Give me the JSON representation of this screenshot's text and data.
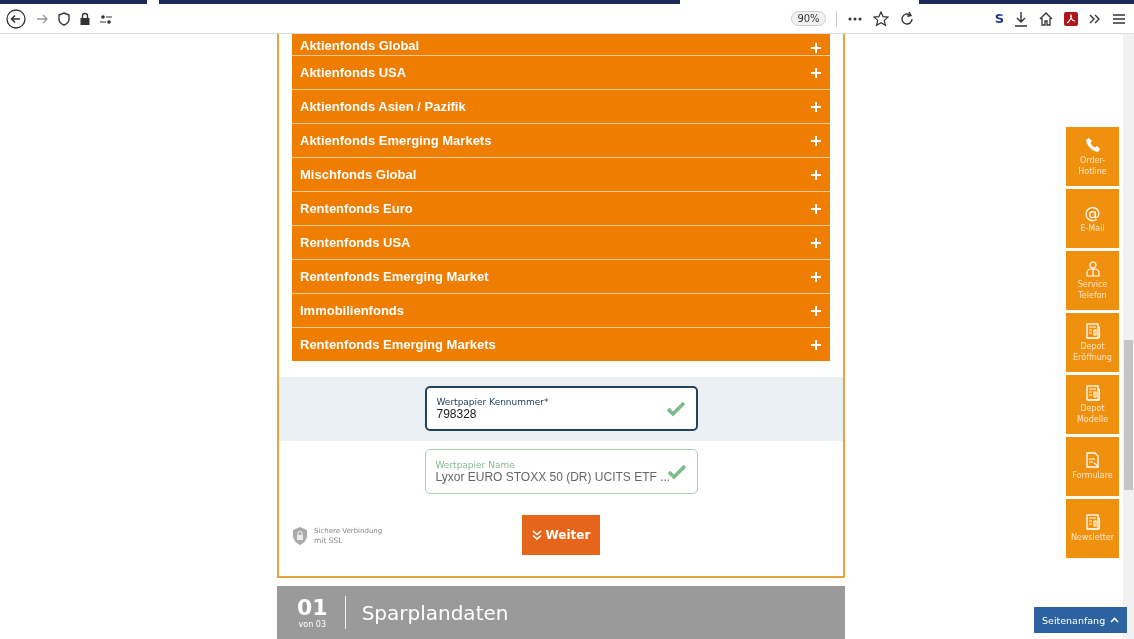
{
  "browser": {
    "zoom": "90%",
    "extension_label": "S"
  },
  "accordion": [
    {
      "label": "Aktienfonds Global",
      "expanded": false
    },
    {
      "label": "Aktienfonds USA",
      "expanded": false
    },
    {
      "label": "Aktienfonds Asien / Pazifik",
      "expanded": false
    },
    {
      "label": "Aktienfonds Emerging Markets",
      "expanded": false
    },
    {
      "label": "Mischfonds Global",
      "expanded": false
    },
    {
      "label": "Rentenfonds Euro",
      "expanded": false
    },
    {
      "label": "Rentenfonds USA",
      "expanded": false
    },
    {
      "label": "Rentenfonds Emerging Market",
      "expanded": false
    },
    {
      "label": "Immobilienfonds",
      "expanded": false
    },
    {
      "label": "Rentenfonds Emerging Markets",
      "expanded": false
    }
  ],
  "fields": [
    {
      "label": "Wertpapier Kennummer*",
      "value": "798328",
      "valid": true,
      "focused": true
    },
    {
      "label": "Wertpapier Name",
      "value": "Lyxor EURO STOXX 50 (DR) UCITS ETF ...",
      "valid": true,
      "focused": false
    }
  ],
  "secure_note": {
    "line_1": "Sichere Verbindung",
    "line_2": "mit SSL"
  },
  "continue_button": {
    "label": "Weiter"
  },
  "step": {
    "number": "01",
    "of": "von 03",
    "title": "Sparplandaten"
  },
  "side_menu": [
    {
      "kind": "phone",
      "lines": [
        "Order-",
        "Hotline"
      ]
    },
    {
      "kind": "at",
      "symbol": "@",
      "lines": [
        "E-Mail"
      ]
    },
    {
      "kind": "person",
      "lines": [
        "Service",
        "Telefon"
      ]
    },
    {
      "kind": "document",
      "lines": [
        "Depot",
        "Eröffnung"
      ]
    },
    {
      "kind": "document",
      "lines": [
        "Depot",
        "Modelle"
      ]
    },
    {
      "kind": "form",
      "lines": [
        "Formulare"
      ]
    },
    {
      "kind": "document",
      "lines": [
        "Newsletter"
      ]
    }
  ],
  "back_to_top": {
    "label": "Seitenanfang"
  }
}
